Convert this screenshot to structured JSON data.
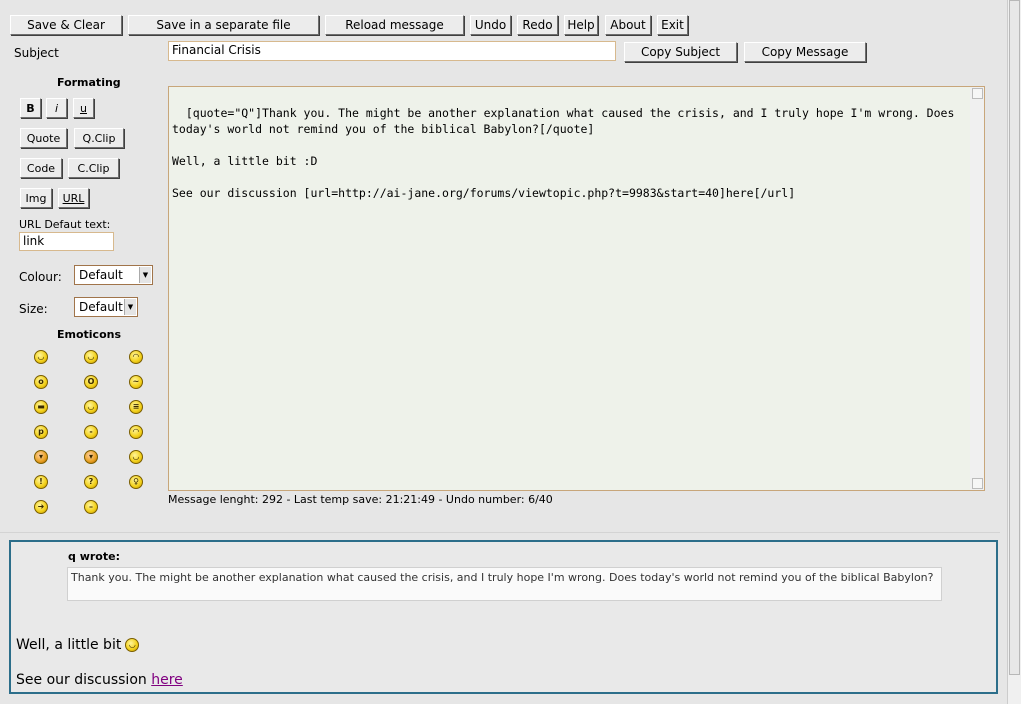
{
  "toolbar": {
    "save_clear": "Save & Clear",
    "save_file": "Save in a separate file",
    "reload": "Reload message",
    "undo": "Undo",
    "redo": "Redo",
    "help": "Help",
    "about": "About",
    "exit": "Exit"
  },
  "subject": {
    "label": "Subject",
    "value": "Financial Crisis",
    "copy_subject": "Copy Subject",
    "copy_message": "Copy Message"
  },
  "formatting": {
    "heading": "Formating",
    "bold": "B",
    "italic": "i",
    "underline": "u",
    "quote": "Quote",
    "qclip": "Q.Clip",
    "code": "Code",
    "cclip": "C.Clip",
    "img": "Img",
    "url": "URL",
    "url_default_label": "URL Defaut text:",
    "url_default_value": "link",
    "colour_label": "Colour:",
    "colour_value": "Default",
    "size_label": "Size:",
    "size_value": "Default"
  },
  "emoticons": {
    "heading": "Emoticons",
    "items": [
      "very-happy",
      "smile",
      "sad",
      "surprised",
      "shocked",
      "confused",
      "cool",
      "laughing",
      "mad",
      "razz",
      "embarrassed",
      "crying",
      "evil",
      "twisted-evil",
      "wink",
      "exclamation",
      "question",
      "idea",
      "arrow",
      "neutral"
    ]
  },
  "editor": {
    "text": "[quote=\"Q\"]Thank you. The might be another explanation what caused the crisis, and I truly hope I'm wrong. Does today's world not remind you of the biblical Babylon?[/quote]\n\nWell, a little bit :D\n\nSee our discussion [url=http://ai-jane.org/forums/viewtopic.php?t=9983&start=40]here[/url]",
    "status": "Message lenght: 292 - Last temp save: 21:21:49 - Undo number: 6/40"
  },
  "preview": {
    "quote_author": "q wrote:",
    "quote_text": "Thank you. The might be another explanation what caused the crisis, and I truly hope I'm wrong. Does today's world not remind you of the biblical Babylon?",
    "line1_text": "Well, a little bit",
    "line2_prefix": "See our discussion",
    "line2_link": "here"
  },
  "colors": {
    "background": "#e6e6e6",
    "editor_bg": "#eef2ea",
    "preview_border": "#2c6e8a",
    "link": "#800080"
  }
}
